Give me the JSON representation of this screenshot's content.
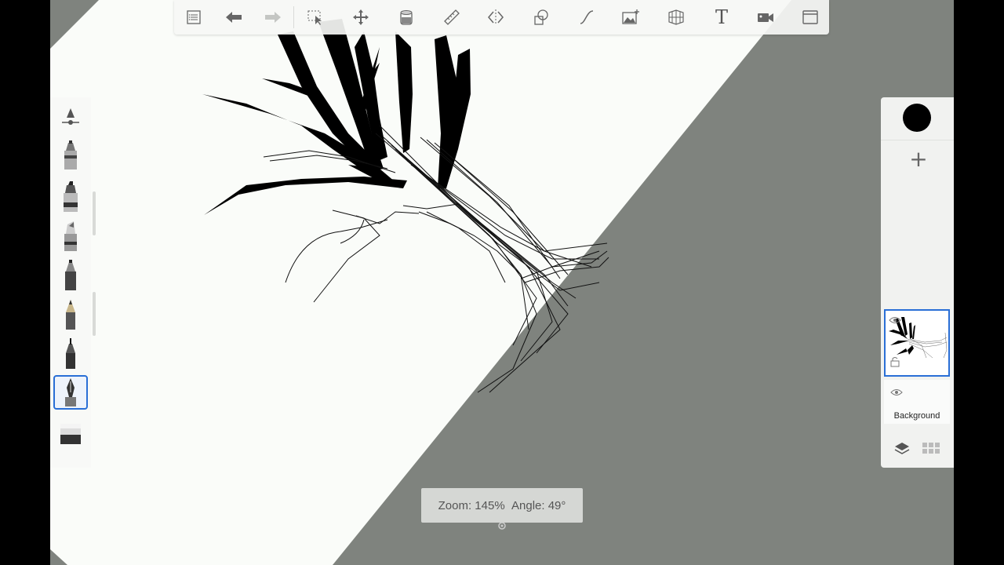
{
  "toolbar": {
    "items": [
      "menu-icon",
      "undo-icon",
      "redo-icon",
      "selection-icon",
      "transform-icon",
      "fill-icon",
      "ruler-icon",
      "symmetry-icon",
      "shape-icon",
      "curve-icon",
      "image-icon",
      "perspective-icon",
      "text-icon",
      "record-icon",
      "fullscreen-icon"
    ],
    "text_tool_label": "T"
  },
  "brushes": [
    "brush-settings-icon",
    "airbrush",
    "marker",
    "chisel-marker",
    "pen",
    "pencil",
    "fineliner",
    "ballpoint-pen",
    "eraser"
  ],
  "layers": {
    "add_label": "+",
    "items": [
      {
        "name": "",
        "selected": true,
        "visible": true
      },
      {
        "name": "Background",
        "selected": false,
        "visible": true
      }
    ],
    "current_color": "#000000"
  },
  "zoom_popup": {
    "zoom": "Zoom: 145%",
    "angle": "Angle: 49°"
  },
  "colors": {
    "accent": "#2a6fd6",
    "outside_canvas": "#7f837e",
    "paper": "#fafcf9"
  }
}
